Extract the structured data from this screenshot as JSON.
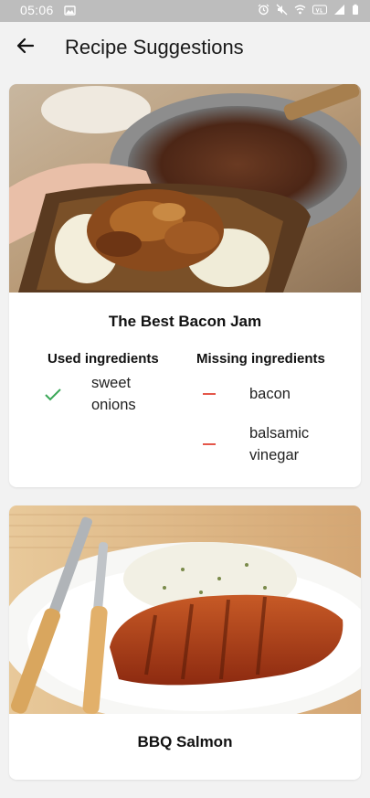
{
  "status_bar": {
    "time": "05:06",
    "background": "#bdbdbd"
  },
  "app_bar": {
    "title": "Recipe Suggestions",
    "back_icon": "arrow-left-icon"
  },
  "recipes": [
    {
      "title": "The Best Bacon Jam",
      "used_heading": "Used ingredients",
      "missing_heading": "Missing ingredients",
      "used": [
        "sweet onions"
      ],
      "missing": [
        "bacon",
        "balsamic vinegar"
      ]
    },
    {
      "title": "BBQ Salmon"
    }
  ],
  "colors": {
    "used_check": "#3aa757",
    "missing_dash": "#e4574a",
    "background": "#f2f2f2",
    "card": "#ffffff"
  }
}
